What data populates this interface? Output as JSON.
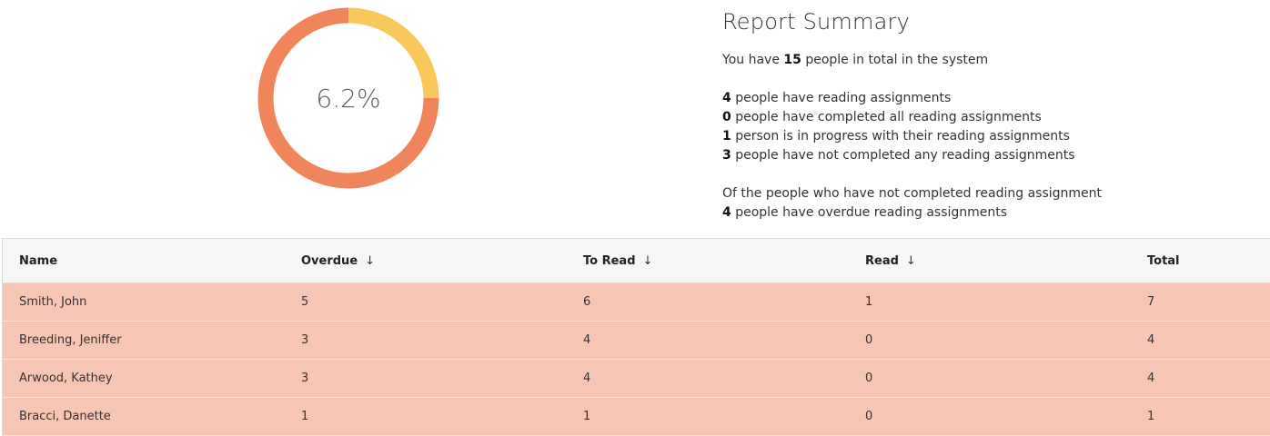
{
  "donut": {
    "center_label": "6.2%",
    "segments": [
      {
        "fraction": 0.25,
        "color": "#f9c85a"
      },
      {
        "fraction": 0.75,
        "color": "#f0845a"
      }
    ]
  },
  "summary": {
    "title": "Report Summary",
    "total_prefix": "You have",
    "total_count": "15",
    "total_suffix": "people in total in the system",
    "stats": [
      {
        "count": "4",
        "text": "people have reading assignments"
      },
      {
        "count": "0",
        "text": "people have completed all reading assignments"
      },
      {
        "count": "1",
        "text": "person is in progress with their reading assignments"
      },
      {
        "count": "3",
        "text": "people have not completed any reading assignments"
      }
    ],
    "overdue_intro": "Of the people who have not completed reading assignment",
    "overdue_count": "4",
    "overdue_text": "people have overdue reading assignments"
  },
  "table": {
    "headers": {
      "name": "Name",
      "overdue": "Overdue",
      "to_read": "To Read",
      "read": "Read",
      "total": "Total",
      "sort_icon": "↓"
    },
    "rows": [
      {
        "name": "Smith, John",
        "overdue": "5",
        "to_read": "6",
        "read": "1",
        "total": "7"
      },
      {
        "name": "Breeding, Jeniffer",
        "overdue": "3",
        "to_read": "4",
        "read": "0",
        "total": "4"
      },
      {
        "name": "Arwood, Kathey",
        "overdue": "3",
        "to_read": "4",
        "read": "0",
        "total": "4"
      },
      {
        "name": "Bracci, Danette",
        "overdue": "1",
        "to_read": "1",
        "read": "0",
        "total": "1"
      }
    ]
  },
  "colors": {
    "row_highlight": "#f6c6b4",
    "header_bg": "#f7f7f7"
  }
}
